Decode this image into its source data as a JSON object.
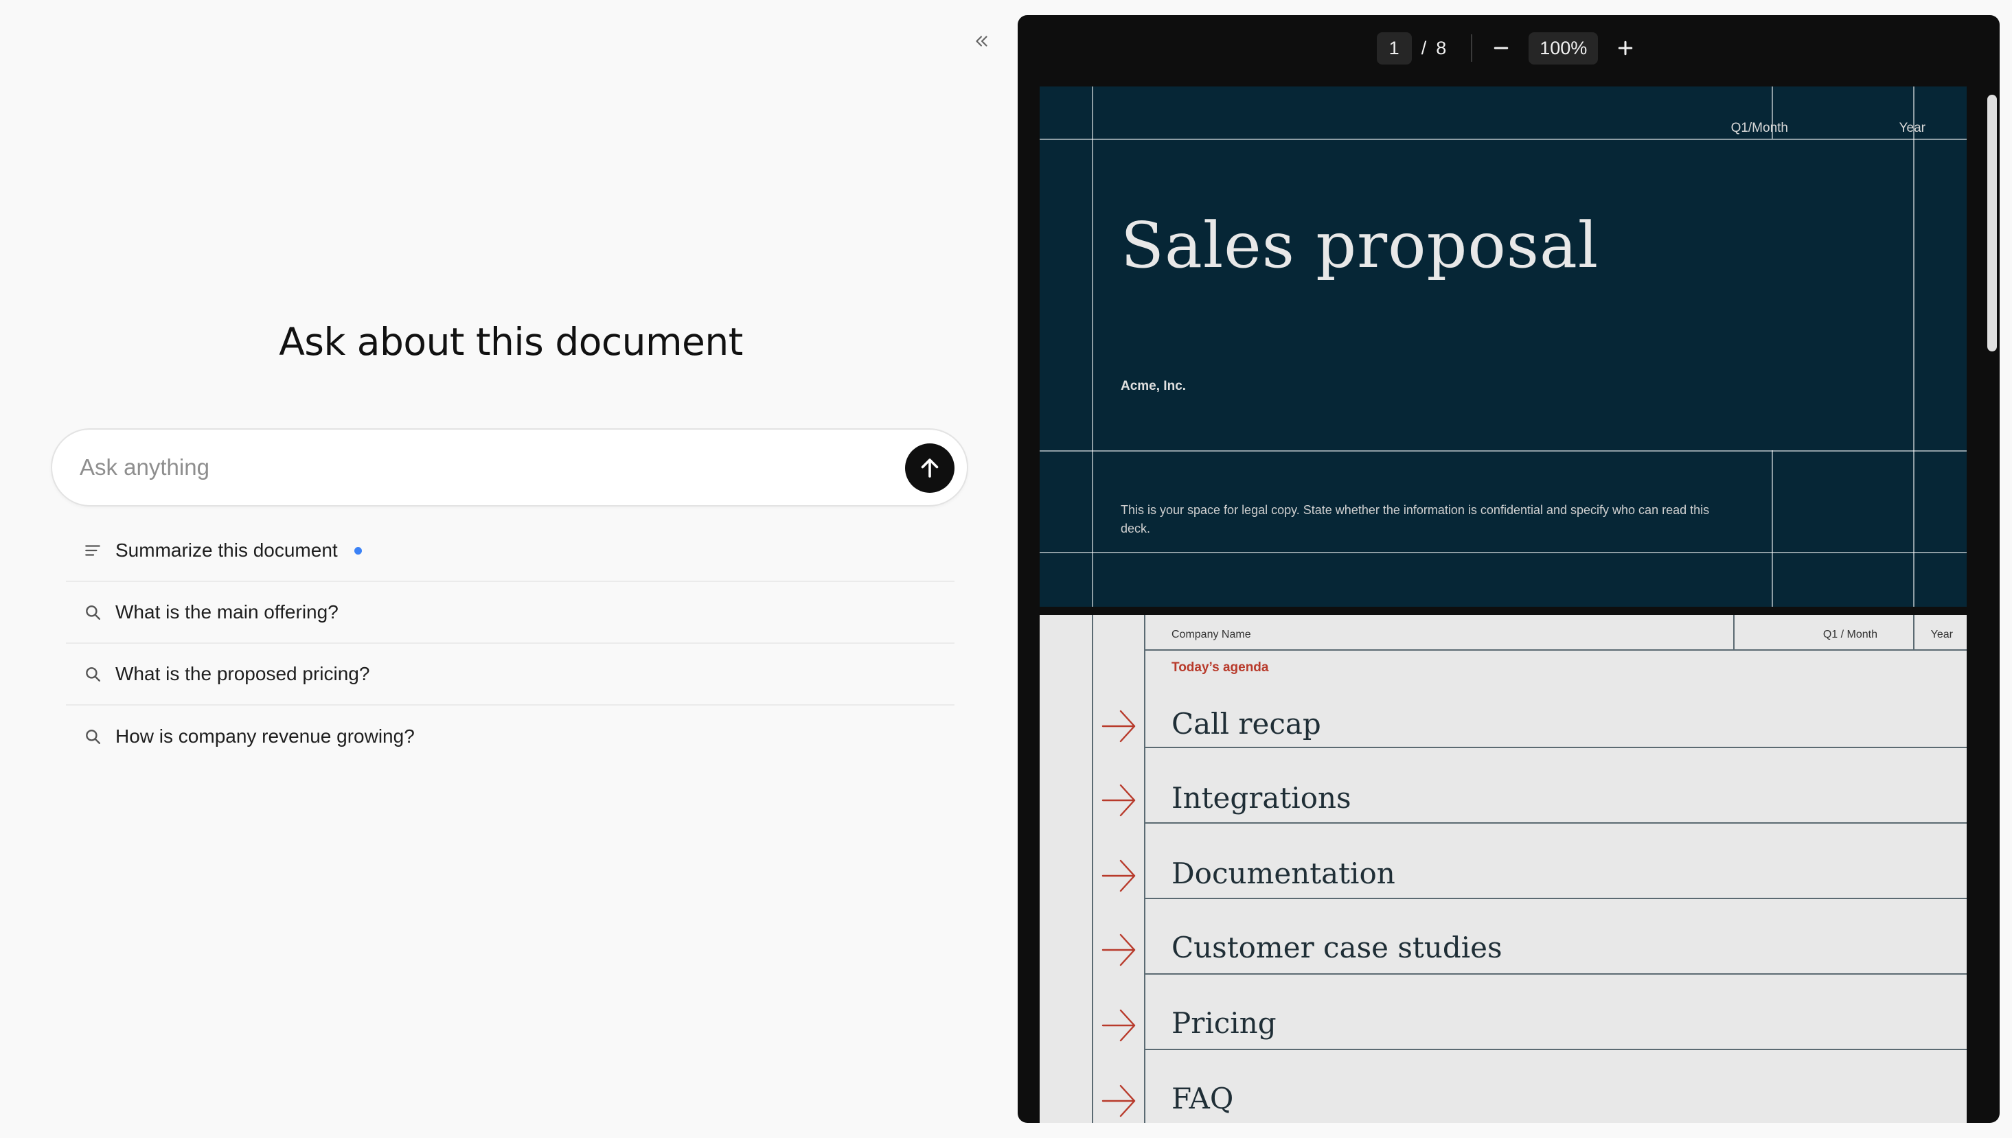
{
  "chat": {
    "title": "Ask about this document",
    "input_placeholder": "Ask anything",
    "input_value": "",
    "suggestions": [
      {
        "label": "Summarize this document",
        "icon": "summarize-lines-icon",
        "new": true
      },
      {
        "label": "What is the main offering?",
        "icon": "search-icon",
        "new": false
      },
      {
        "label": "What is the proposed pricing?",
        "icon": "search-icon",
        "new": false
      },
      {
        "label": "How is company revenue growing?",
        "icon": "search-icon",
        "new": false
      }
    ]
  },
  "viewer": {
    "current_page": "1",
    "separator": "/",
    "total_pages": "8",
    "zoom": "100%"
  },
  "slide1": {
    "period_label": "Q1/Month",
    "year_label": "Year",
    "title": "Sales proposal",
    "company": "Acme, Inc.",
    "legal_text": "This is your space for legal copy. State whether the information is confidential and specify who can read this deck."
  },
  "slide2": {
    "company_label": "Company Name",
    "period_label": "Q1 / Month",
    "year_label": "Year",
    "agenda_heading": "Today’s agenda",
    "agenda_items": [
      "Call recap",
      "Integrations",
      "Documentation",
      "Customer case studies",
      "Pricing",
      "FAQ"
    ]
  },
  "colors": {
    "send_button": "#0f0f0f",
    "new_dot": "#3b82f6",
    "slide1_bg": "#062636",
    "slide2_bg": "#e8e8e8",
    "accent_red": "#b83a2b",
    "viewer_bg": "#0e0e0e"
  }
}
